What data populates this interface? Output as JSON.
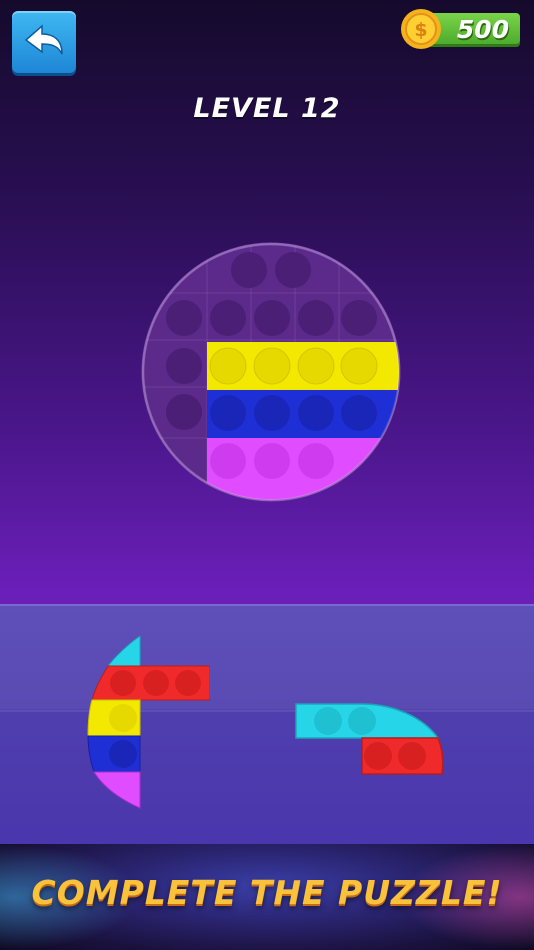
{
  "header": {
    "back_icon": "back-arrow-icon",
    "coins": {
      "icon": "coin-icon",
      "coin_symbol": "$",
      "value": "500"
    }
  },
  "level": {
    "title": "LEVEL 12"
  },
  "board": {
    "shape": "circle",
    "base_color": "#5b2a8a",
    "filled_rows": [
      {
        "color": "#f2e800",
        "bubbles": 4
      },
      {
        "color": "#1f2fd6",
        "bubbles": 4
      },
      {
        "color": "#e04cff",
        "bubbles": 3
      }
    ]
  },
  "tray": {
    "pieces": [
      {
        "name": "left-piece",
        "colors": [
          "#26d6e8",
          "#f02a2a",
          "#f2e800",
          "#1f2fd6",
          "#e04cff"
        ]
      },
      {
        "name": "right-piece",
        "colors": [
          "#26d6e8",
          "#f02a2a"
        ]
      }
    ]
  },
  "banner": {
    "text": "COMPLETE THE PUZZLE!"
  }
}
